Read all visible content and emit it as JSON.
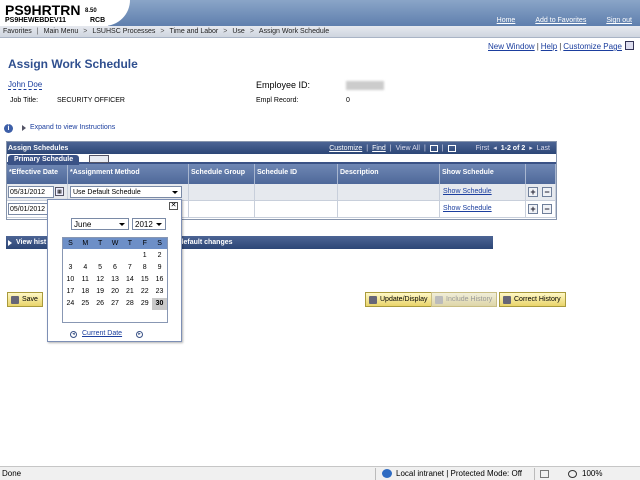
{
  "app": {
    "title": "PS9HRTRN",
    "version": "8.50",
    "db_name": "PS9HEWEBDEV11",
    "db_user": "RCB"
  },
  "top_links": [
    "Home",
    "Add to Favorites",
    "Sign out"
  ],
  "breadcrumb": [
    "Favorites",
    "Main Menu",
    "LSUHSC Processes",
    "Time and Labor",
    "Use",
    "Assign Work Schedule"
  ],
  "util_links": [
    "New Window",
    "Help",
    "Customize Page"
  ],
  "page_title": "Assign Work Schedule",
  "employee": {
    "name": "John Doe",
    "id_label": "Employee ID:",
    "job_title_label": "Job Title:",
    "job_title": "SECURITY OFFICER",
    "empl_record_label": "Empl Record:",
    "empl_record": "0"
  },
  "expand_instructions": "Expand to view Instructions",
  "grid": {
    "title": "Assign Schedules",
    "nav": {
      "customize": "Customize",
      "find": "Find",
      "view_all": "View All",
      "first": "First",
      "range": "1-2 of 2",
      "last": "Last"
    },
    "tab": "Primary Schedule",
    "columns": [
      "*Effective Date",
      "*Assignment Method",
      "Schedule Group",
      "Schedule ID",
      "Description",
      "Show Schedule"
    ],
    "rows": [
      {
        "date": "05/31/2012",
        "method": "Use Default Schedule",
        "show": "Show Schedule"
      },
      {
        "date": "05/01/2012",
        "method": "",
        "show": "Show Schedule"
      }
    ]
  },
  "history_bar": {
    "left": "View hist",
    "right": "g default changes"
  },
  "buttons": {
    "save": "Save",
    "update_display": "Update/Display",
    "include_history": "Include History",
    "correct_history": "Correct History"
  },
  "calendar": {
    "month": "June",
    "year": "2012",
    "weekdays": [
      "S",
      "M",
      "T",
      "W",
      "T",
      "F",
      "S"
    ],
    "weeks": [
      [
        "",
        "",
        "",
        "",
        "",
        "1",
        "2"
      ],
      [
        "3",
        "4",
        "5",
        "6",
        "7",
        "8",
        "9"
      ],
      [
        "10",
        "11",
        "12",
        "13",
        "14",
        "15",
        "16"
      ],
      [
        "17",
        "18",
        "19",
        "20",
        "21",
        "22",
        "23"
      ],
      [
        "24",
        "25",
        "26",
        "27",
        "28",
        "29",
        "30"
      ]
    ],
    "selected": "30",
    "current_date": "Current Date"
  },
  "status_bar": {
    "left": "Done",
    "zone": "Local intranet | Protected Mode: Off",
    "zoom": "100%"
  },
  "colors": {
    "header_blue": "#2c4676",
    "link_blue": "#1b3e9e",
    "button_yellow": "#e9d46a"
  }
}
